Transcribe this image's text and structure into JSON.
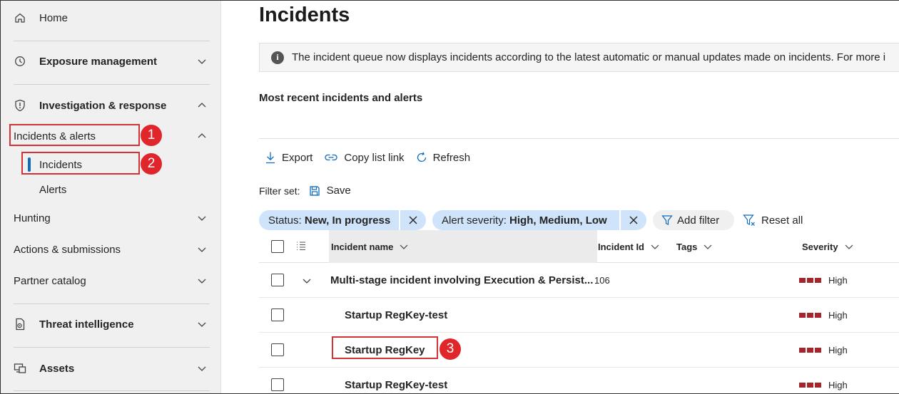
{
  "sidebar": {
    "home": "Home",
    "exposure": "Exposure management",
    "investigation": "Investigation & response",
    "incidents_alerts": "Incidents & alerts",
    "incidents": "Incidents",
    "alerts": "Alerts",
    "hunting": "Hunting",
    "actions": "Actions & submissions",
    "partner": "Partner catalog",
    "threat": "Threat intelligence",
    "assets": "Assets"
  },
  "annotations": {
    "one": "1",
    "two": "2",
    "three": "3"
  },
  "main": {
    "title": "Incidents",
    "banner": "The incident queue now displays incidents according to the latest automatic or manual updates made on incidents. For more i",
    "subtitle": "Most recent incidents and alerts",
    "toolbar": {
      "export": "Export",
      "copy": "Copy list link",
      "refresh": "Refresh"
    },
    "filterset_label": "Filter set:",
    "save": "Save",
    "filters": [
      {
        "key": "Status:",
        "value": "New, In progress"
      },
      {
        "key": "Alert severity:",
        "value": "High, Medium, Low"
      }
    ],
    "add_filter": "Add filter",
    "reset_all": "Reset all"
  },
  "table": {
    "columns": {
      "name": "Incident name",
      "id": "Incident Id",
      "tags": "Tags",
      "severity": "Severity"
    },
    "rows": [
      {
        "name": "Multi-stage incident involving Execution & Persist...",
        "id": "106",
        "severity": "High"
      },
      {
        "name": "Startup RegKey-test",
        "id": "",
        "severity": "High"
      },
      {
        "name": "Startup RegKey",
        "id": "",
        "severity": "High"
      },
      {
        "name": "Startup RegKey-test",
        "id": "",
        "severity": "High"
      }
    ]
  },
  "colors": {
    "accent": "#0f6cbd",
    "annotation": "#e0262b",
    "severity_high": "#a4262c",
    "pill": "#cfe4fa"
  }
}
